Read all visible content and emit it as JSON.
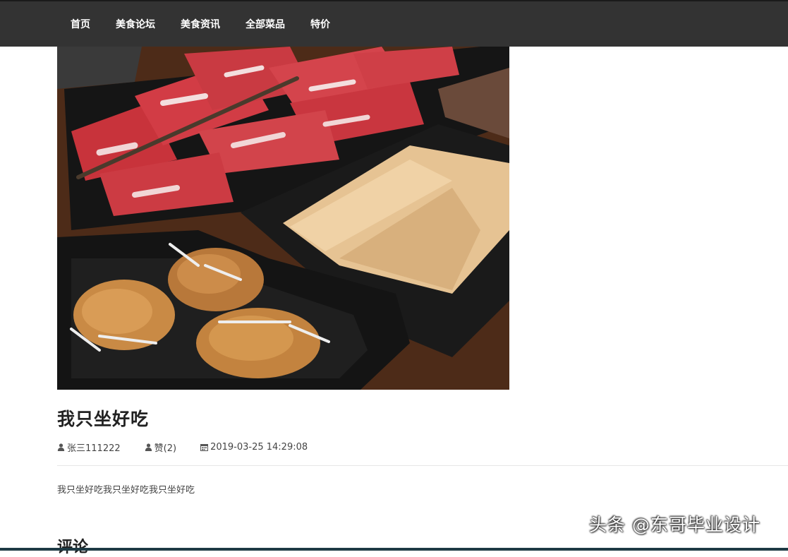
{
  "nav": {
    "items": [
      {
        "label": "首页"
      },
      {
        "label": "美食论坛"
      },
      {
        "label": "美食资讯"
      },
      {
        "label": "全部菜品"
      },
      {
        "label": "特价"
      }
    ]
  },
  "post": {
    "title": "我只坐好吃",
    "author": "张三111222",
    "likes": "赞(2)",
    "datetime": "2019-03-25 14:29:08",
    "body": "我只坐好吃我只坐好吃我只坐好吃"
  },
  "comments": {
    "heading": "评论"
  },
  "watermark": {
    "text": "头条 @东哥毕业设计"
  },
  "icons": {
    "author": "user-icon",
    "likes": "user-icon",
    "date": "calendar-icon"
  },
  "colors": {
    "topbar": "#333333",
    "divider": "#e6e6e6"
  }
}
